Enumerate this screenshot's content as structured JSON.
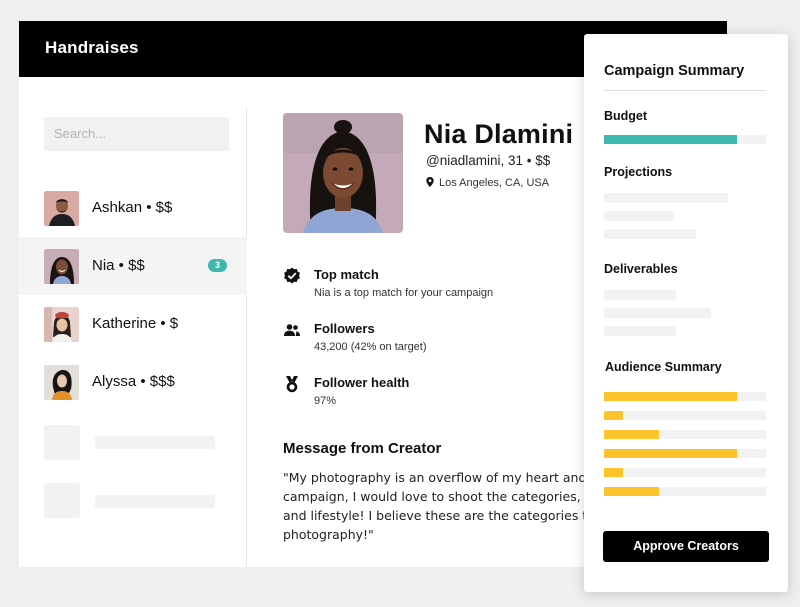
{
  "app": {
    "title": "Handraises"
  },
  "search": {
    "placeholder": "Search..."
  },
  "creators": [
    {
      "label": "Ashkan • $$"
    },
    {
      "label": "Nia • $$",
      "badge": "3",
      "selected": true
    },
    {
      "label": "Katherine • $"
    },
    {
      "label": "Alyssa • $$$"
    }
  ],
  "profile": {
    "name": "Nia Dlamini",
    "handle": "@niadlamini, 31 • $$",
    "location": "Los Angeles, CA, USA"
  },
  "stats": [
    {
      "title": "Top match",
      "sub": "Nia is a top match for your campaign",
      "icon": "verified-badge-icon"
    },
    {
      "title": "Followers",
      "sub": "43,200 (42% on target)",
      "icon": "users-icon"
    },
    {
      "title": "Follower health",
      "sub": "97%",
      "icon": "medal-icon"
    }
  ],
  "message": {
    "title": "Message from Creator",
    "lines": [
      "\"My photography is an overflow of my heart and ambition",
      "campaign, I would love to shoot the categories, People &",
      "and lifestyle! I believe these are the categories that best",
      "photography!\""
    ]
  },
  "summary": {
    "title": "Campaign Summary",
    "budget_label": "Budget",
    "budget_fraction": 0.82,
    "projections_label": "Projections",
    "deliverables_label": "Deliverables",
    "audience_label": "Audience Summary",
    "audience_fractions": [
      0.82,
      0.12,
      0.34,
      0.82,
      0.12,
      0.34
    ],
    "approve_label": "Approve Creators"
  },
  "colors": {
    "budget": "#3db7b0",
    "audience": "#fcc32b",
    "badge": "#3db7b0",
    "topbar": "#000000"
  }
}
